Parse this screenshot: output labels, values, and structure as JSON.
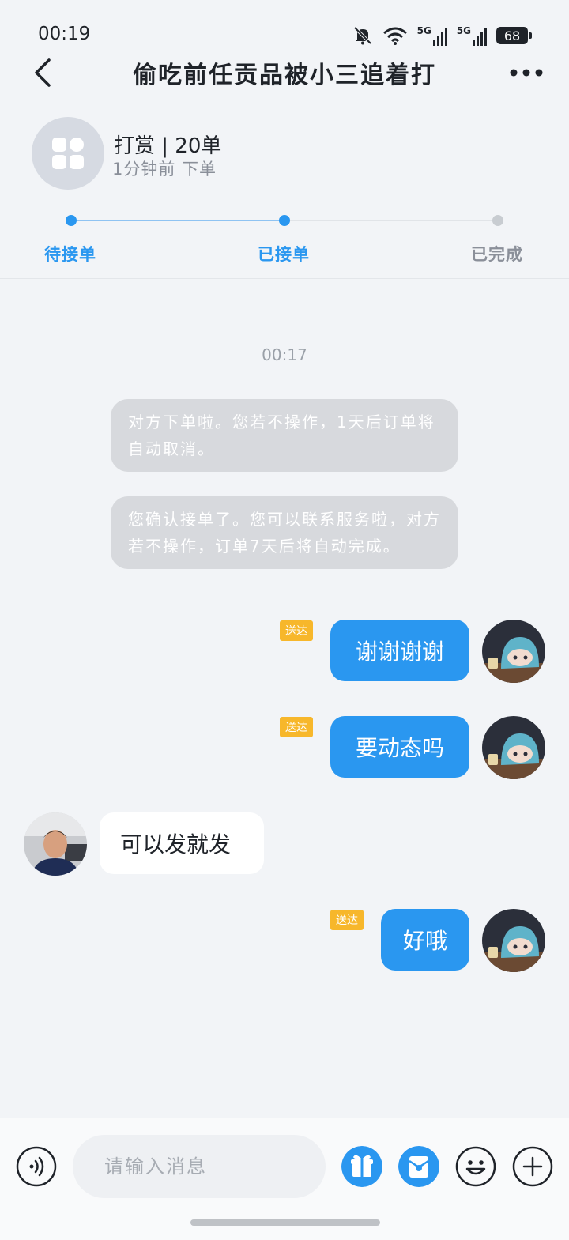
{
  "status_bar": {
    "time": "00:19",
    "battery": "68",
    "network_1": "5G",
    "network_2": "5G"
  },
  "header": {
    "title": "偷吃前任贡品被小三追着打"
  },
  "order": {
    "type": "打赏 | 20单",
    "time_ago": "1分钟前 下单"
  },
  "progress": {
    "steps": [
      {
        "label": "待接单",
        "state": "done"
      },
      {
        "label": "已接单",
        "state": "current"
      },
      {
        "label": "已完成",
        "state": "pending"
      }
    ],
    "colors": {
      "active": "#2a97f0",
      "inactive": "#c8ccd1",
      "inactive_text": "#8a8f99"
    }
  },
  "chat": {
    "timestamp": "00:17",
    "system_messages": [
      "对方下单啦。您若不操作，1天后订单将自动取消。",
      "您确认接单了。您可以联系服务啦，对方若不操作，订单7天后将自动完成。"
    ],
    "messages": [
      {
        "direction": "out",
        "text": "谢谢谢谢",
        "status": "送达"
      },
      {
        "direction": "out",
        "text": "要动态吗",
        "status": "送达"
      },
      {
        "direction": "in",
        "text": "可以发就发"
      },
      {
        "direction": "out",
        "text": "好哦",
        "status": "送达"
      }
    ]
  },
  "input": {
    "placeholder": "请输入消息"
  },
  "colors": {
    "accent": "#2a97f0",
    "badge": "#f7b72b",
    "system_bubble": "#d7d9dd",
    "background": "#f2f4f7"
  },
  "icons": {
    "left": "voice-icon",
    "right": [
      "gift-icon",
      "red-packet-icon",
      "emoji-icon",
      "plus-icon"
    ]
  }
}
